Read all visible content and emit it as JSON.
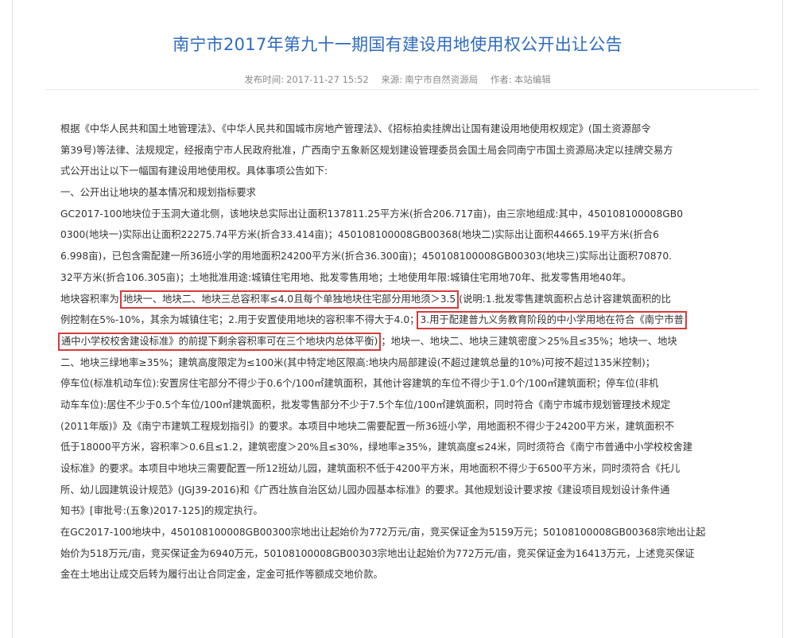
{
  "article": {
    "title": "南宁市2017年第九十一期国有建设用地使用权公开出让公告",
    "meta": {
      "date_label": "发布时间:",
      "date": "2017-11-27 15:52",
      "source_label": "来源:",
      "source": "南宁市自然资源局",
      "author_label": "作者:",
      "author": "本站编辑"
    },
    "lines": [
      "根据《中华人民共和国土地管理法》、《中华人民共和国城市房地产管理法》、《招标拍卖挂牌出让国有建设用地使用权规定》(国土资源部令",
      "第39号)等法律、法规规定，经报南宁市人民政府批准，广西南宁五象新区规划建设管理委员会国土局会同南宁市国土资源局决定以挂牌交易方",
      "式公开出让以下一幅国有建设用地使用权。具体事项公告如下:",
      "一、公开出让地块的基本情况和规划指标要求",
      "GC2017-100地块位于玉洞大道北侧，该地块总实际出让面积137811.25平方米(折合206.717亩)，由三宗地组成:其中，450108100008GB0",
      "0300(地块一)实际出让面积22275.74平方米(折合33.414亩)；450108100008GB00368(地块二)实际出让面积44665.19平方米(折合6",
      "6.998亩)，已包含需配建一所36班小学的用地面积24200平方米(折合36.300亩)；450108100008GB00303(地块三)实际出让面积70870.",
      "32平方米(折合106.305亩)；土地批准用途:城镇住宅用地、批发零售用地；土地使用年限:城镇住宅用地70年、批发零售用地40年。"
    ],
    "far": {
      "prefix": "地块容积率为:",
      "hl1": "地块一、地块二、地块三总容积率≤4.0且每个单独地块住宅部分用地须＞3.5",
      "line9_tail": "(说明:1.批发零售建筑面积占总计容建筑面积的比",
      "line10_head": "例控制在5%-10%，其余为城镇住宅；2.用于安置使用地块的容积率不得大于4.0；",
      "hl2a": "3.用于配建普九义务教育阶段的中小学用地在符合《南宁市普",
      "hl2b": "通中小学校校舍建设标准》的前提下剩余容积率可在三个地块内总体平衡)",
      "line11_tail": "；地块一、地块二、地块三建筑密度＞25%且≤35%；地块一、地块"
    },
    "lines2": [
      "二、地块三绿地率≥35%；建筑高度限定为≤100米(其中特定地区限高:地块内局部建设(不超过建筑总量的10%)可按不超过135米控制)；",
      "停车位(标准机动车位):安置房住宅部分不得少于0.6个/100㎡建筑面积，其他计容建筑的车位不得少于1.0个/100㎡建筑面积；停车位(非机",
      "动车车位):居住不少于0.5个车位/100㎡建筑面积，批发零售部分不少于7.5个车位/100㎡建筑面积，同时符合《南宁市城市规划管理技术规定",
      "(2011年版)》及《南宁市建筑工程规划指引》的要求。本项目中地块二需要配置一所36班小学，用地面积不得少于24200平方米，建筑面积不",
      "低于18000平方米，容积率＞0.6且≤1.2，建筑密度＞20%且≤30%，绿地率≥35%，建筑高度≤24米，同时须符合《南宁市普通中小学校校舍建",
      "设标准》的要求。本项目中地块三需要配置一所12班幼儿园，建筑面积不低于4200平方米，用地面积不得少于6500平方米，同时须符合《托儿",
      "所、幼儿园建筑设计规范》(JGJ39-2016)和《广西壮族自治区幼儿园办园基本标准》的要求。其他规划设计要求按《建设项目规划设计条件通",
      "知书》[审批号:(五象)2017-125]的规定执行。",
      "在GC2017-100地块中，450108100008GB00300宗地出让起始价为772万元/亩，竞买保证金为5159万元；50108100008GB00368宗地出让起",
      "始价为518万元/亩，竞买保证金为6940万元，50108100008GB00303宗地出让起始价为772万元/亩，竞买保证金为16413万元，上述竞买保证",
      "金在土地出让成交后转为履行出让合同定金，定金可抵作等额成交地价款。"
    ],
    "colors": {
      "title": "#2f6bbf",
      "highlight_border": "#d83a3a",
      "meta": "#8a8a8a"
    }
  }
}
